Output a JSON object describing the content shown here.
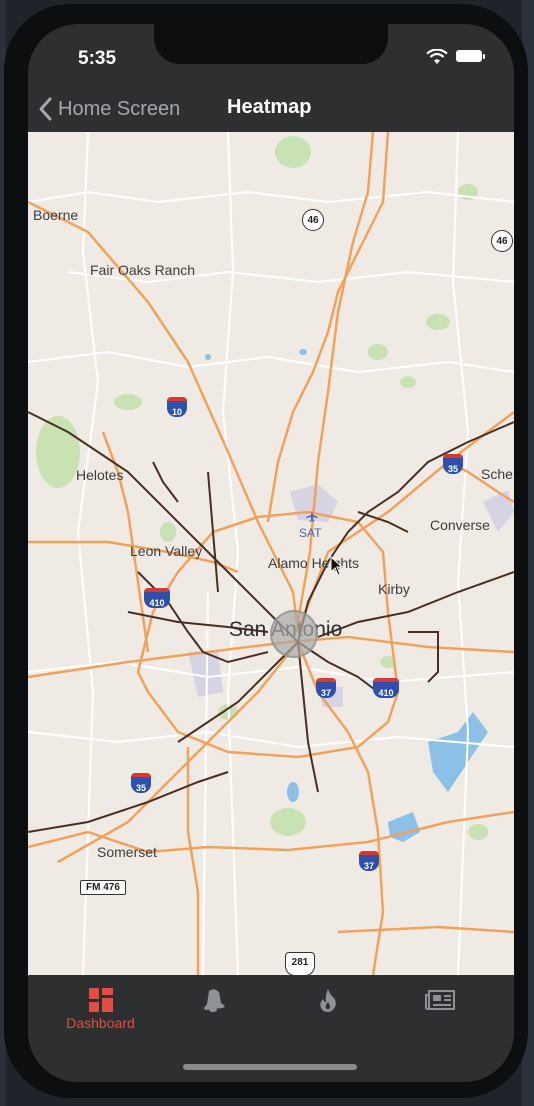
{
  "status_bar": {
    "time": "5:35"
  },
  "nav": {
    "back_label": "Home Screen",
    "title": "Heatmap"
  },
  "map": {
    "places": {
      "boerne": "Boerne",
      "fair_oaks": "Fair Oaks Ranch",
      "helotes": "Helotes",
      "leon_valley": "Leon Valley",
      "alamo_heights": "Alamo Heights",
      "san_antonio": "San Antonio",
      "converse": "Converse",
      "kirby": "Kirby",
      "schertz": "Sche",
      "somerset": "Somerset",
      "airport": "SAT"
    },
    "shields": {
      "i10": "10",
      "i35_ne": "35",
      "i410_w": "410",
      "i37_c": "37",
      "i410_e": "410",
      "i35_sw": "35",
      "i37_s": "37",
      "sh46_a": "46",
      "sh46_b": "46",
      "fm476": "FM 476",
      "us281": "281"
    }
  },
  "tabs": [
    {
      "label": "Dashboard",
      "icon": "dashboard-icon",
      "active": true
    },
    {
      "label": "",
      "icon": "bell-icon",
      "active": false
    },
    {
      "label": "",
      "icon": "flame-icon",
      "active": false
    },
    {
      "label": "",
      "icon": "news-icon",
      "active": false
    }
  ],
  "colors": {
    "active_tab": "#e14d43",
    "inactive_tab": "#8e9196",
    "highway": "#f0a25a",
    "road": "#4a2e22"
  }
}
